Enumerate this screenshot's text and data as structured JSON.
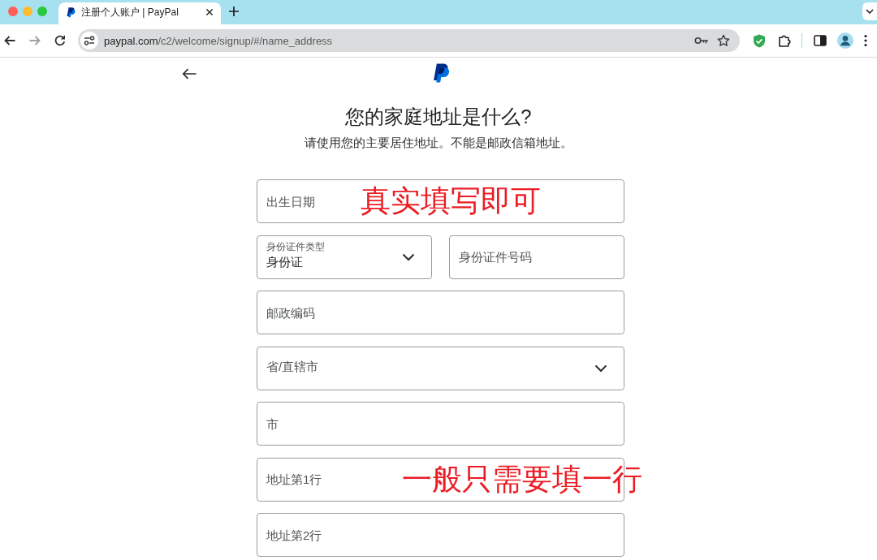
{
  "browser": {
    "tabs": [
      {
        "title": "注册个人账户 | PayPal",
        "selected": true
      }
    ],
    "nav_buttons": [
      {
        "kind": "back",
        "disabled": false
      },
      {
        "kind": "forward",
        "disabled": true
      },
      {
        "kind": "reload",
        "disabled": false
      }
    ],
    "address": {
      "host": "paypal.com",
      "path": "/c2/welcome/signup/#/name_address"
    }
  },
  "page": {
    "heading": "您的家庭地址是什么?",
    "subtitle": "请使用您的主要居住地址。不能是邮政信箱地址。"
  },
  "form": {
    "rows": [
      [
        {
          "kind": "input",
          "placeholder": "出生日期",
          "annotation": "真实填写即可"
        }
      ],
      [
        {
          "kind": "select",
          "label": "身份证件类型",
          "value": "身份证"
        },
        {
          "kind": "input",
          "placeholder": "身份证件号码"
        }
      ],
      [
        {
          "kind": "input",
          "placeholder": "邮政编码"
        }
      ],
      [
        {
          "kind": "select",
          "label": "省/直辖市"
        }
      ],
      [
        {
          "kind": "input",
          "placeholder": "市"
        }
      ],
      [
        {
          "kind": "input",
          "placeholder": "地址第1行",
          "annotation": "一般只需要填一行"
        }
      ],
      [
        {
          "kind": "input",
          "placeholder": "地址第2行"
        }
      ]
    ]
  }
}
